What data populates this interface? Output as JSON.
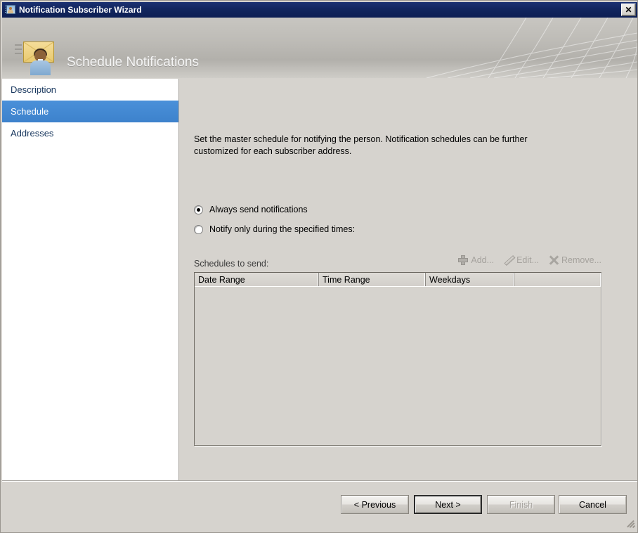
{
  "window": {
    "title": "Notification Subscriber Wizard",
    "title_icon": "subscriber-window-icon",
    "close_label": "✕"
  },
  "banner": {
    "heading": "Schedule Notifications",
    "icon": "envelope-person-icon"
  },
  "sidebar": {
    "items": [
      {
        "label": "Description",
        "selected": false
      },
      {
        "label": "Schedule",
        "selected": true
      },
      {
        "label": "Addresses",
        "selected": false
      }
    ]
  },
  "main": {
    "description": "Set the master schedule for notifying the person. Notification schedules can be further customized for each subscriber address.",
    "options": [
      {
        "label": "Always send notifications",
        "checked": true
      },
      {
        "label": "Notify only during the specified times:",
        "checked": false
      }
    ],
    "list_label": "Schedules to send:",
    "toolbar": [
      {
        "label": "Add...",
        "icon": "plus-icon",
        "enabled": false
      },
      {
        "label": "Edit...",
        "icon": "pencil-icon",
        "enabled": false
      },
      {
        "label": "Remove...",
        "icon": "x-icon",
        "enabled": false
      }
    ],
    "table": {
      "columns": [
        "Date Range",
        "Time Range",
        "Weekdays",
        ""
      ],
      "rows": []
    }
  },
  "footer": {
    "buttons": [
      {
        "label": "< Previous",
        "state": "enabled"
      },
      {
        "label": "Next >",
        "state": "default"
      },
      {
        "label": "Finish",
        "state": "disabled"
      },
      {
        "label": "Cancel",
        "state": "enabled"
      }
    ]
  },
  "colors": {
    "titlebar": "#12265e",
    "selection": "#3d82cc",
    "face": "#d6d3ce",
    "sidebar_text": "#17365d"
  }
}
